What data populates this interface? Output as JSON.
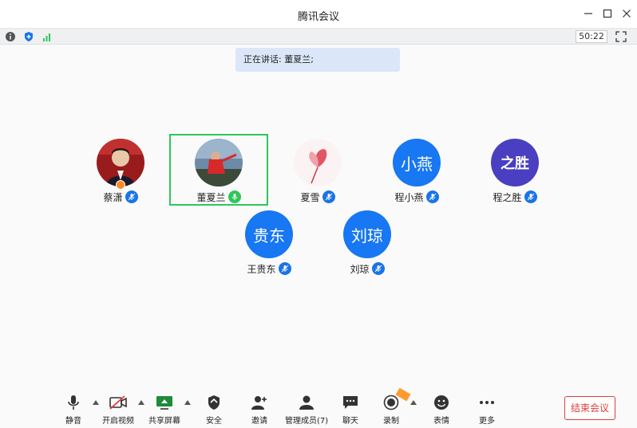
{
  "window": {
    "title": "腾讯会议"
  },
  "status": {
    "timer": "50:22"
  },
  "speaking": {
    "text": "正在讲话: 董夏兰;"
  },
  "participants": [
    {
      "name": "蔡潇",
      "avatar_text": "",
      "avatar_kind": "photo"
    },
    {
      "name": "董夏兰",
      "avatar_text": "",
      "avatar_kind": "photo"
    },
    {
      "name": "夏雪",
      "avatar_text": "",
      "avatar_kind": "photo"
    },
    {
      "name": "程小燕",
      "avatar_text": "小燕",
      "avatar_kind": "text"
    },
    {
      "name": "程之胜",
      "avatar_text": "之胜",
      "avatar_kind": "text"
    },
    {
      "name": "王贵东",
      "avatar_text": "贵东",
      "avatar_kind": "text"
    },
    {
      "name": "刘琼",
      "avatar_text": "刘琼",
      "avatar_kind": "text"
    }
  ],
  "toolbar": {
    "mute": "静音",
    "video": "开启视频",
    "share": "共享屏幕",
    "security": "安全",
    "invite": "邀请",
    "members": "管理成员(7)",
    "chat": "聊天",
    "record": "录制",
    "emoji": "表情",
    "more": "更多",
    "end": "结束会议"
  },
  "colors": {
    "accent": "#1a73e8",
    "active_border": "#2ec65a",
    "danger": "#e23b3b"
  }
}
